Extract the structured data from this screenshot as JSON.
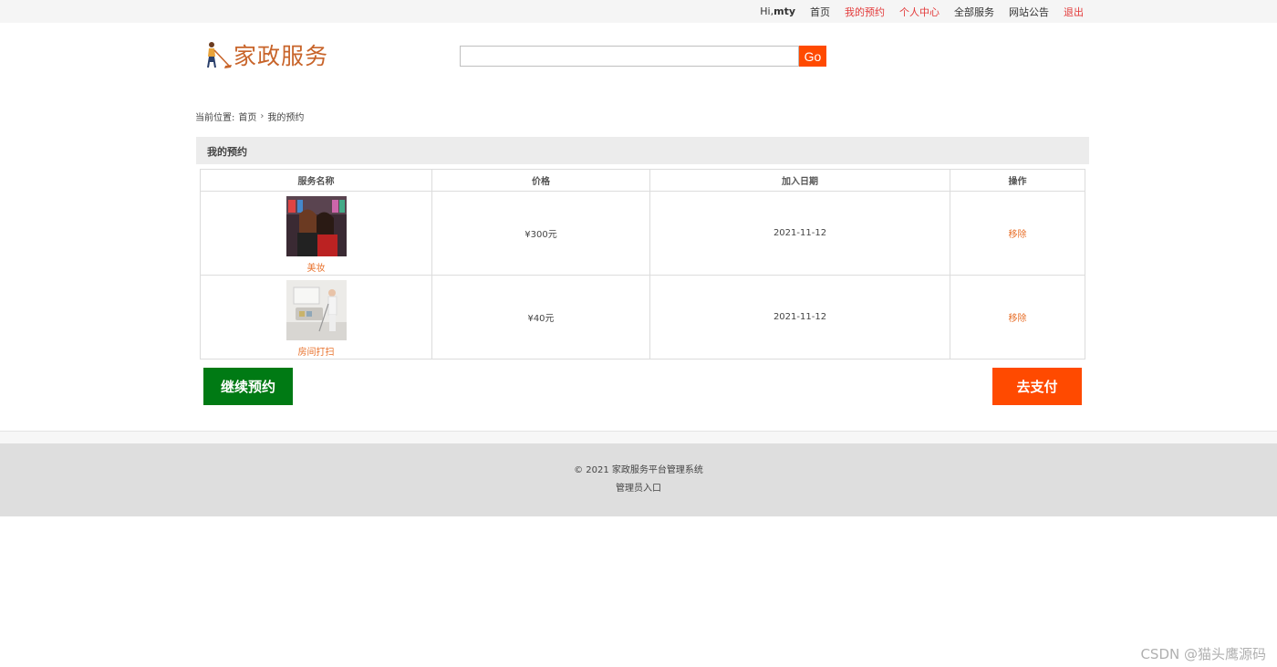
{
  "topbar": {
    "greeting_prefix": "Hi,",
    "username": "mty",
    "links": [
      "首页",
      "我的预约",
      "个人中心",
      "全部服务",
      "网站公告",
      "退出"
    ]
  },
  "logo": {
    "text": "家政服务",
    "icon": "housekeeper-mopping-icon"
  },
  "search": {
    "value": "",
    "button_label": "Go"
  },
  "breadcrumb": {
    "prefix": "当前位置:",
    "home": "首页",
    "separator": "›",
    "current": "我的预约"
  },
  "panel": {
    "title": "我的预约"
  },
  "table": {
    "headers": [
      "服务名称",
      "价格",
      "加入日期",
      "操作"
    ],
    "rows": [
      {
        "name": "美妆",
        "price": "¥300元",
        "date": "2021-11-12",
        "action": "移除",
        "thumb": "makeup-photo"
      },
      {
        "name": "房间打扫",
        "price": "¥40元",
        "date": "2021-11-12",
        "action": "移除",
        "thumb": "room-cleaning-photo"
      }
    ]
  },
  "buttons": {
    "continue": "继续预约",
    "pay": "去支付"
  },
  "footer": {
    "copyright": "© 2021 家政服务平台管理系统",
    "admin_link": "管理员入口"
  },
  "watermark": "CSDN @猫头鹰源码",
  "colors": {
    "accent": "#ff4a00",
    "continue_green": "#007a14",
    "logo_brown": "#c8642a",
    "link_red": "#e33b3b"
  }
}
